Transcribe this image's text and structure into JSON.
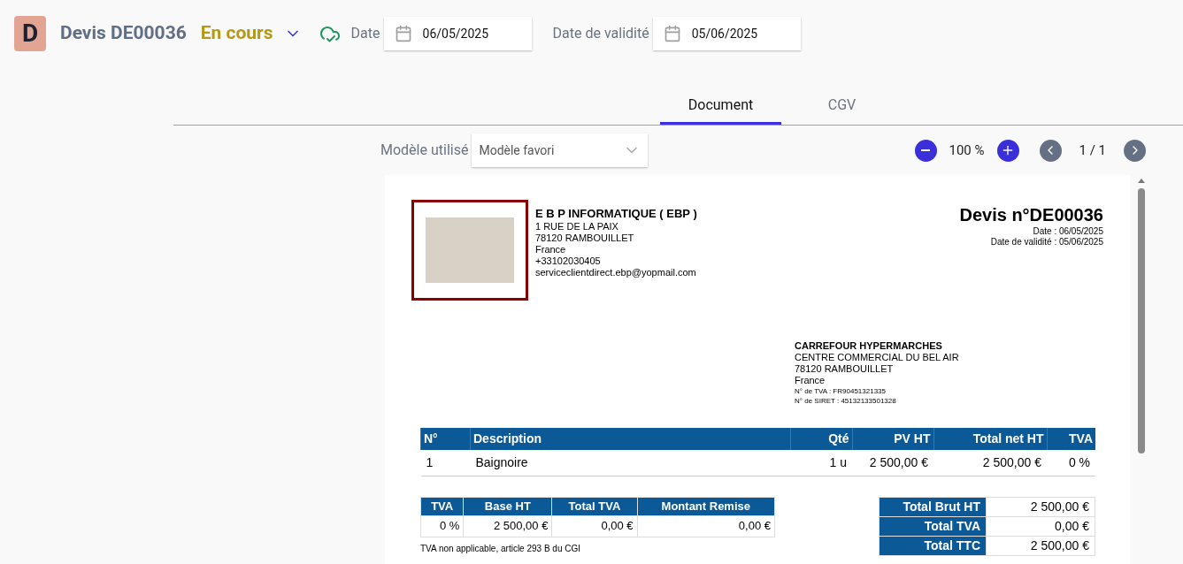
{
  "header": {
    "avatar_letter": "D",
    "title": "Devis DE00036",
    "status": "En cours",
    "synced": true,
    "date_label": "Date",
    "date_value": "06/05/2025",
    "validity_label": "Date de validité",
    "validity_value": "05/06/2025"
  },
  "tabs": [
    {
      "label": "Document",
      "selected": true
    },
    {
      "label": "CGV",
      "selected": false
    }
  ],
  "toolbar": {
    "template_label": "Modèle utilisé",
    "template_value": "Modèle favori",
    "zoom": "100 %",
    "page": "1 / 1"
  },
  "document": {
    "company": {
      "name": "E B P INFORMATIQUE ( EBP )",
      "lines": [
        "1 RUE DE LA PAIX",
        "78120 RAMBOUILLET",
        "France",
        "+33102030405",
        "serviceclientdirect.ebp@yopmail.com"
      ]
    },
    "title": "Devis n°DE00036",
    "meta": [
      "Date : 06/05/2025",
      "Date de validité : 05/06/2025"
    ],
    "client": {
      "lines": [
        "CARREFOUR HYPERMARCHES",
        "CENTRE COMMERCIAL DU BEL AIR",
        "78120 RAMBOUILLET",
        "France"
      ],
      "small_lines": [
        "N° de TVA : FR90451321335",
        "N° de SIRET : 45132133501328"
      ]
    },
    "lines_table": {
      "columns": [
        "N°",
        "Description",
        "Qté",
        "PV HT",
        "Total net HT",
        "TVA"
      ],
      "rows": [
        [
          "1",
          "Baignoire",
          "1 u",
          "2 500,00 €",
          "2 500,00 €",
          "0 %"
        ]
      ]
    },
    "vat_table": {
      "columns": [
        "TVA",
        "Base HT",
        "Total TVA",
        "Montant Remise"
      ],
      "rows": [
        [
          "0 %",
          "2 500,00 €",
          "0,00 €",
          "0,00 €"
        ]
      ]
    },
    "note": "TVA non applicable, article 293 B du CGI",
    "totals": [
      {
        "label": "Total Brut HT",
        "value": "2 500,00 €"
      },
      {
        "label": "Total TVA",
        "value": "0,00 €"
      },
      {
        "label": "Total TTC",
        "value": "2 500,00 €"
      }
    ]
  }
}
